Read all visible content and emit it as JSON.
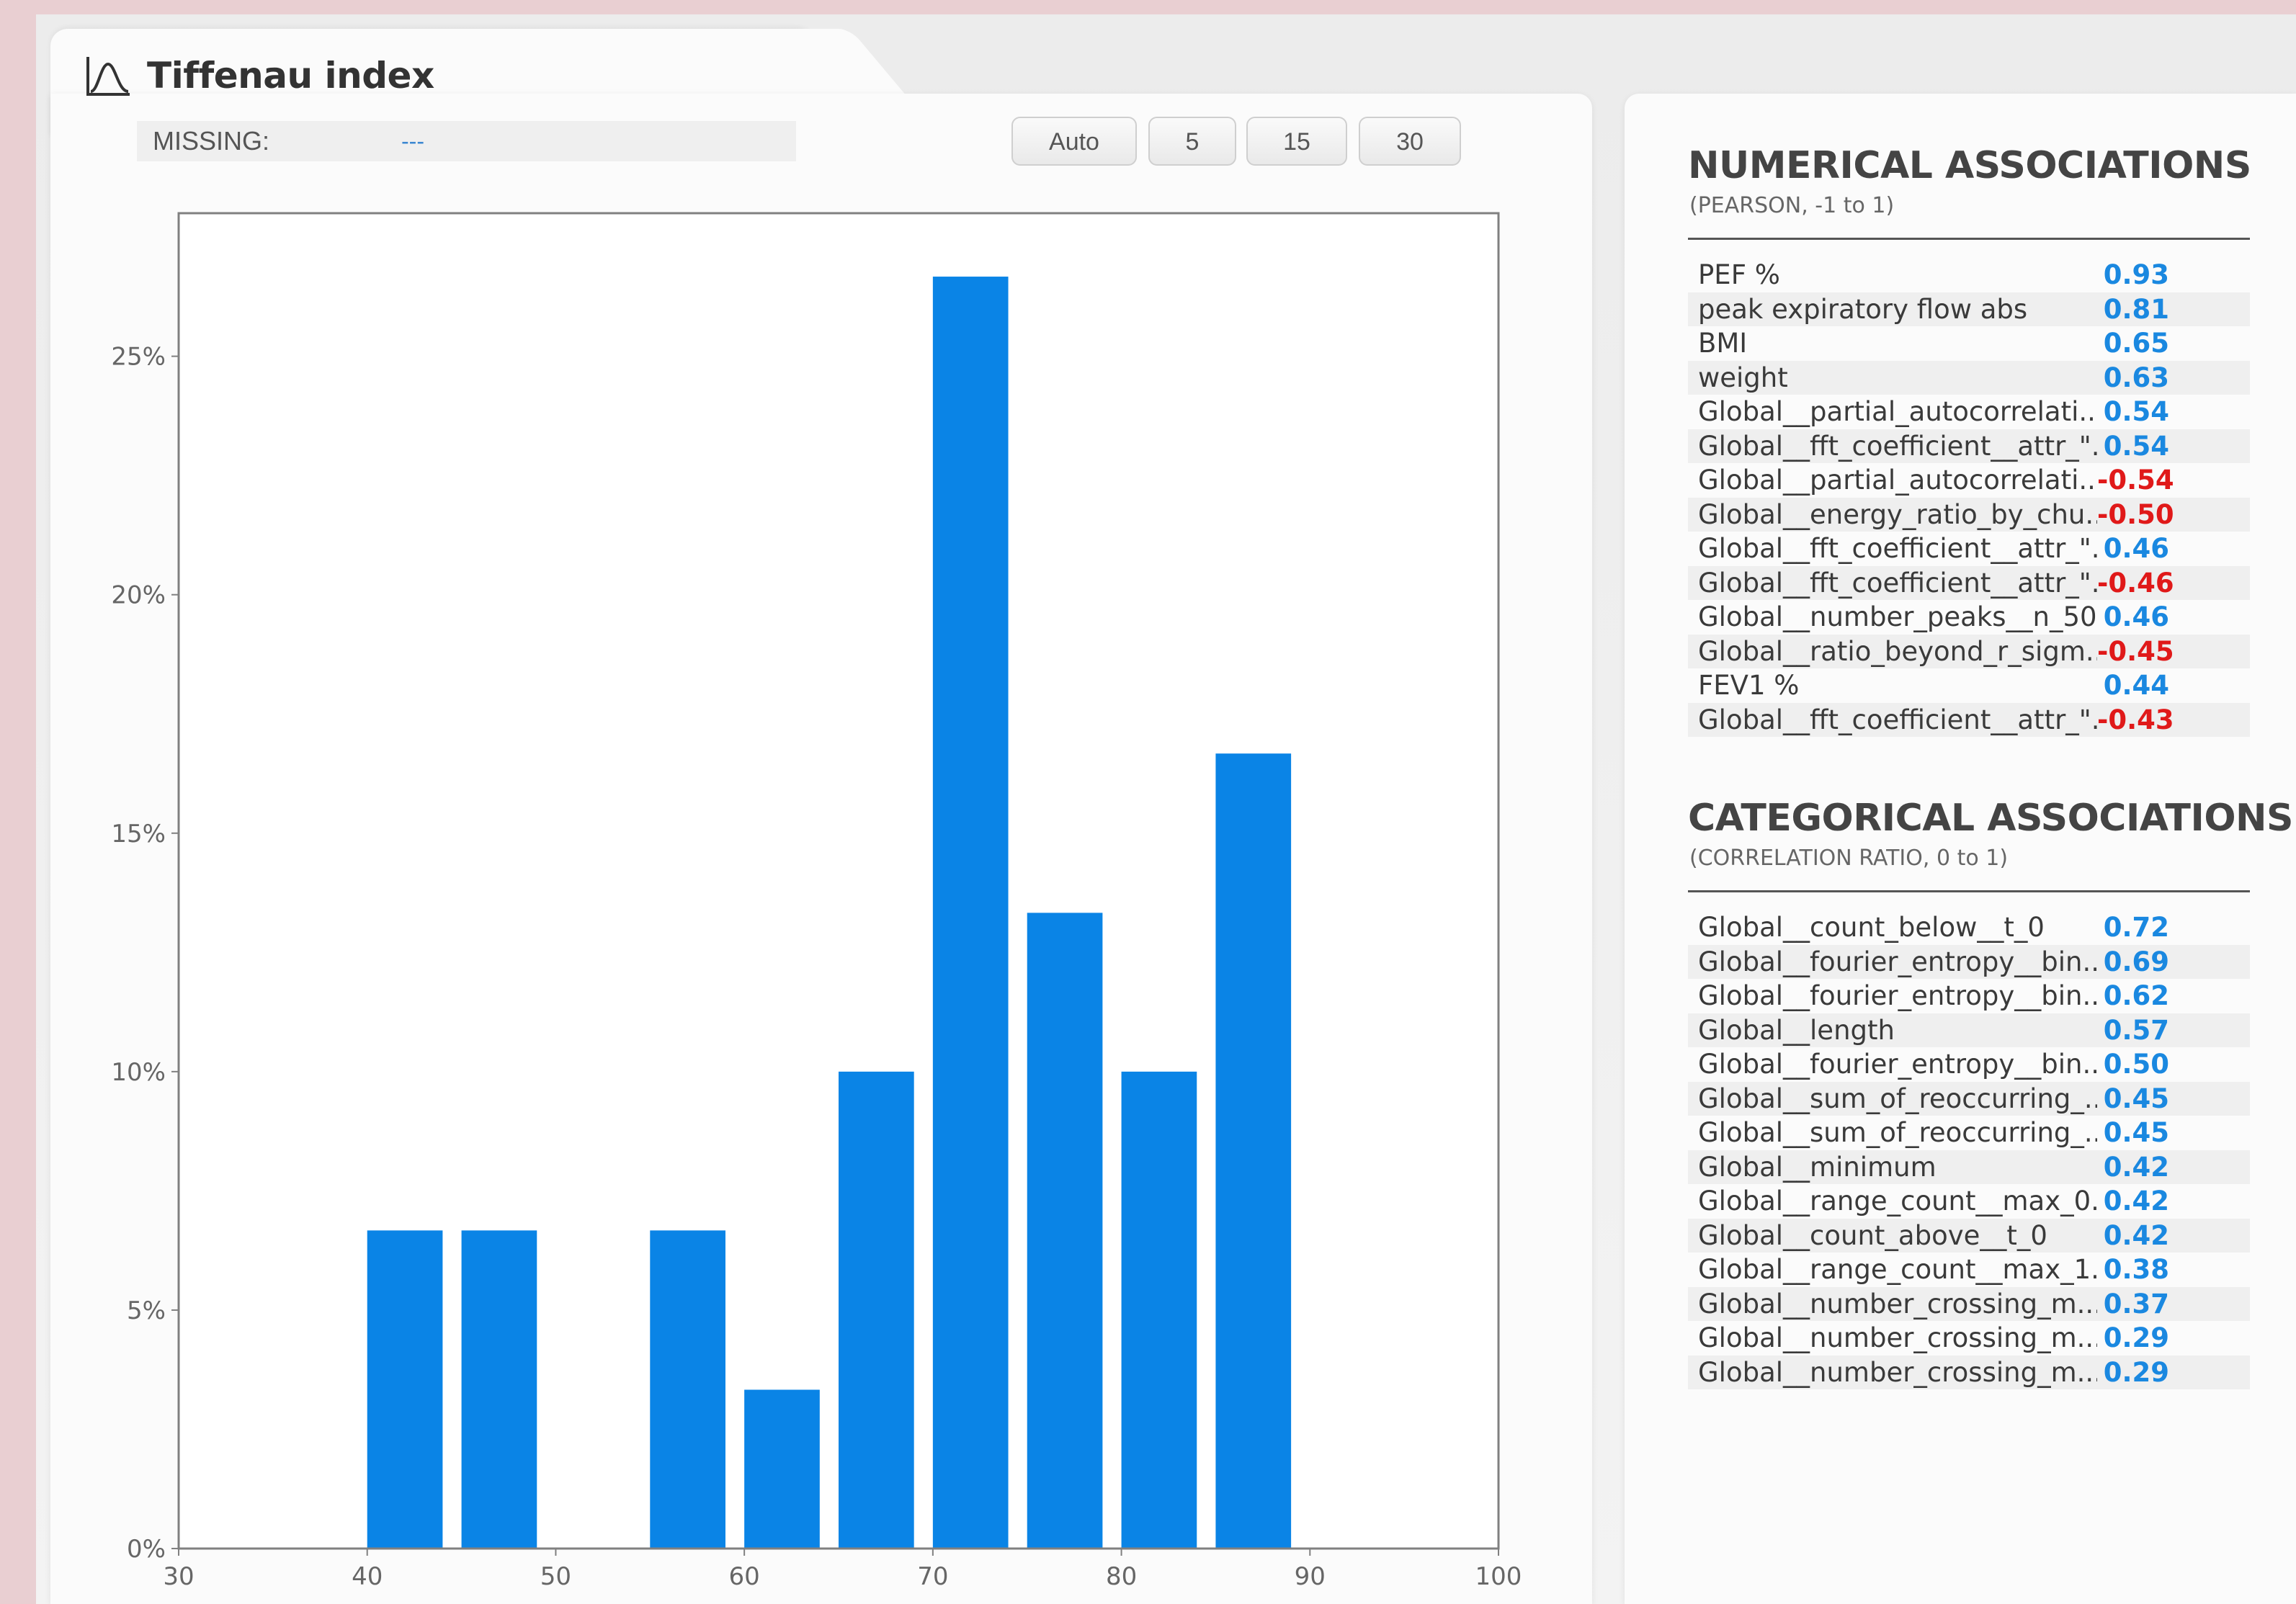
{
  "panel": {
    "title": "Tiffenau index",
    "icon": "distribution-curve-icon",
    "missing_label": "MISSING:",
    "missing_value": "---",
    "bin_buttons": [
      "Auto",
      "5",
      "15",
      "30"
    ]
  },
  "chart_data": {
    "type": "bar",
    "title": "",
    "xlabel": "",
    "ylabel": "",
    "bins": [
      {
        "start": 40,
        "end": 44,
        "value": 6.67
      },
      {
        "start": 45,
        "end": 49,
        "value": 6.67
      },
      {
        "start": 55,
        "end": 59,
        "value": 6.67
      },
      {
        "start": 60,
        "end": 64,
        "value": 3.33
      },
      {
        "start": 65,
        "end": 69,
        "value": 10.0
      },
      {
        "start": 70,
        "end": 74,
        "value": 26.67
      },
      {
        "start": 75,
        "end": 79,
        "value": 13.33
      },
      {
        "start": 80,
        "end": 84,
        "value": 10.0
      },
      {
        "start": 85,
        "end": 89,
        "value": 16.67
      }
    ],
    "xlim": [
      30,
      100
    ],
    "ylim": [
      0,
      28
    ],
    "x_ticks": [
      "30",
      "40",
      "50",
      "60",
      "70",
      "80",
      "90",
      "100"
    ],
    "y_ticks": [
      "0%",
      "5%",
      "10%",
      "15%",
      "20%",
      "25%"
    ],
    "bar_color": "#0a84e6",
    "grid": false
  },
  "numerical": {
    "title": "NUMERICAL ASSOCIATIONS",
    "subtitle": "(PEARSON, -1 to 1)",
    "items": [
      {
        "name": "PEF %",
        "value": "0.93"
      },
      {
        "name": "peak expiratory flow abs",
        "value": "0.81"
      },
      {
        "name": "BMI",
        "value": "0.65"
      },
      {
        "name": "weight",
        "value": "0.63"
      },
      {
        "name": "Global__partial_autocorrelati...",
        "value": "0.54"
      },
      {
        "name": "Global__fft_coefficient__attr_\"...",
        "value": "0.54"
      },
      {
        "name": "Global__partial_autocorrelati...",
        "value": "-0.54"
      },
      {
        "name": "Global__energy_ratio_by_chu...",
        "value": "-0.50"
      },
      {
        "name": "Global__fft_coefficient__attr_\"...",
        "value": "0.46"
      },
      {
        "name": "Global__fft_coefficient__attr_\"...",
        "value": "-0.46"
      },
      {
        "name": "Global__number_peaks__n_50",
        "value": "0.46"
      },
      {
        "name": "Global__ratio_beyond_r_sigm...",
        "value": "-0.45"
      },
      {
        "name": "FEV1 %",
        "value": "0.44"
      },
      {
        "name": "Global__fft_coefficient__attr_\"...",
        "value": "-0.43"
      }
    ]
  },
  "categorical": {
    "title": "CATEGORICAL ASSOCIATIONS",
    "subtitle": "(CORRELATION RATIO, 0 to 1)",
    "items": [
      {
        "name": "Global__count_below__t_0",
        "value": "0.72"
      },
      {
        "name": "Global__fourier_entropy__bin...",
        "value": "0.69"
      },
      {
        "name": "Global__fourier_entropy__bin...",
        "value": "0.62"
      },
      {
        "name": "Global__length",
        "value": "0.57"
      },
      {
        "name": "Global__fourier_entropy__bin...",
        "value": "0.50"
      },
      {
        "name": "Global__sum_of_reoccurring_...",
        "value": "0.45"
      },
      {
        "name": "Global__sum_of_reoccurring_...",
        "value": "0.45"
      },
      {
        "name": "Global__minimum",
        "value": "0.42"
      },
      {
        "name": "Global__range_count__max_0...",
        "value": "0.42"
      },
      {
        "name": "Global__count_above__t_0",
        "value": "0.42"
      },
      {
        "name": "Global__range_count__max_1...",
        "value": "0.38"
      },
      {
        "name": "Global__number_crossing_m...",
        "value": "0.37"
      },
      {
        "name": "Global__number_crossing_m...",
        "value": "0.29"
      },
      {
        "name": "Global__number_crossing_m...",
        "value": "0.29"
      }
    ]
  },
  "colors": {
    "positive": "#1a88e0",
    "negative": "#e01919"
  }
}
